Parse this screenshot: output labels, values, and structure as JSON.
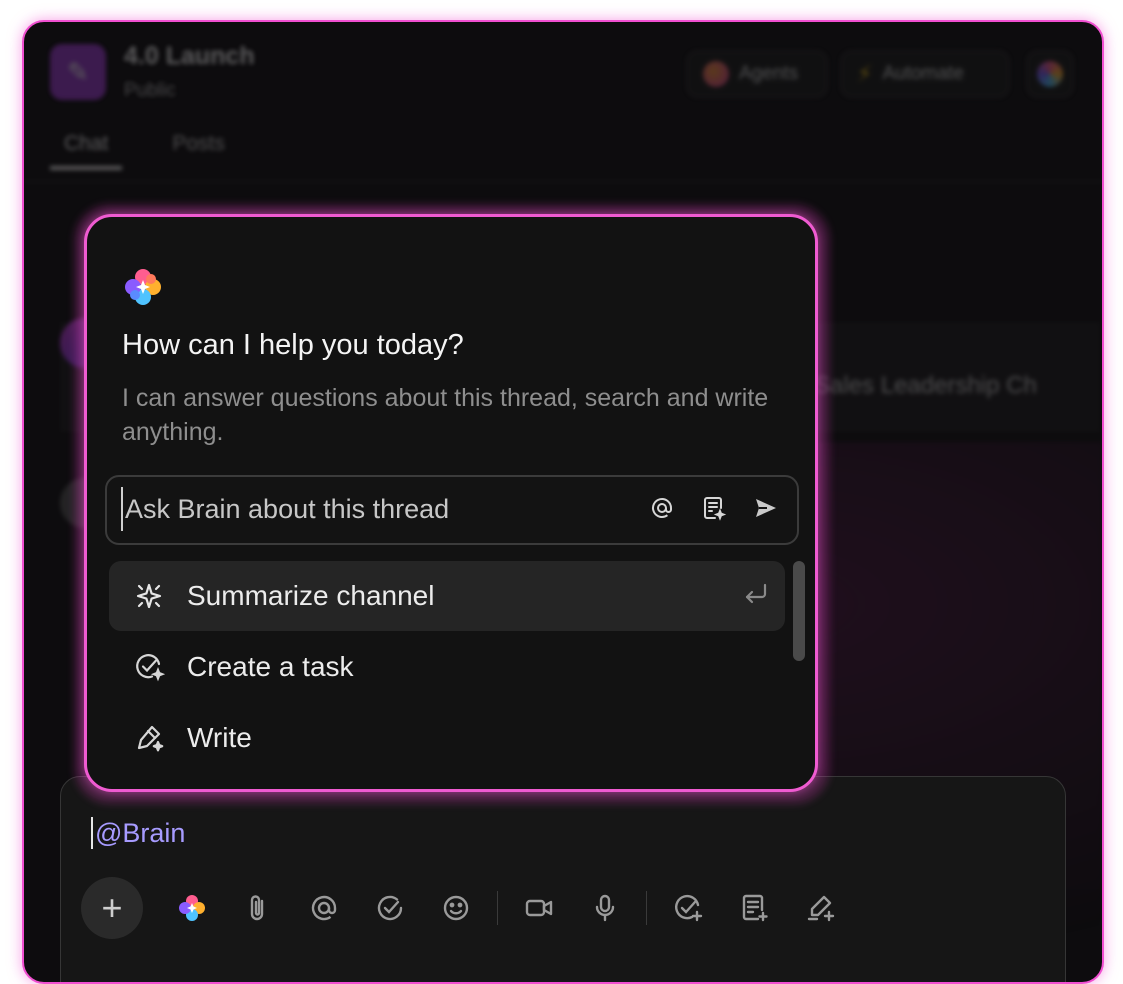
{
  "header": {
    "space_title": "4.0 Launch",
    "space_visibility": "Public",
    "agents_label": "Agents",
    "automate_label": "Automate"
  },
  "tabs": [
    {
      "label": "Chat",
      "active": true
    },
    {
      "label": "Posts",
      "active": false
    }
  ],
  "background_message": {
    "snippet": "e Sales Leadership Ch"
  },
  "brain_popup": {
    "title": "How can I help you today?",
    "description": "I can answer questions about this thread, search and write anything.",
    "input_placeholder": "Ask Brain about this thread",
    "input_value": "",
    "actions": [
      {
        "label": "Summarize channel",
        "icon": "sparkle-icon",
        "highlighted": true
      },
      {
        "label": "Create a task",
        "icon": "task-sparkle-icon",
        "highlighted": false
      },
      {
        "label": "Write",
        "icon": "pen-sparkle-icon",
        "highlighted": false
      }
    ]
  },
  "composer": {
    "text": "@Brain",
    "tools": [
      "plus-icon",
      "brain-icon",
      "attachment-icon",
      "mention-icon",
      "task-icon",
      "emoji-icon",
      "video-icon",
      "microphone-icon",
      "add-task-icon",
      "doc-add-icon",
      "whiteboard-icon"
    ]
  },
  "colors": {
    "accent_pink": "#ef5bd1",
    "mention_color": "#a79bff",
    "background": "#0d0c0e"
  }
}
